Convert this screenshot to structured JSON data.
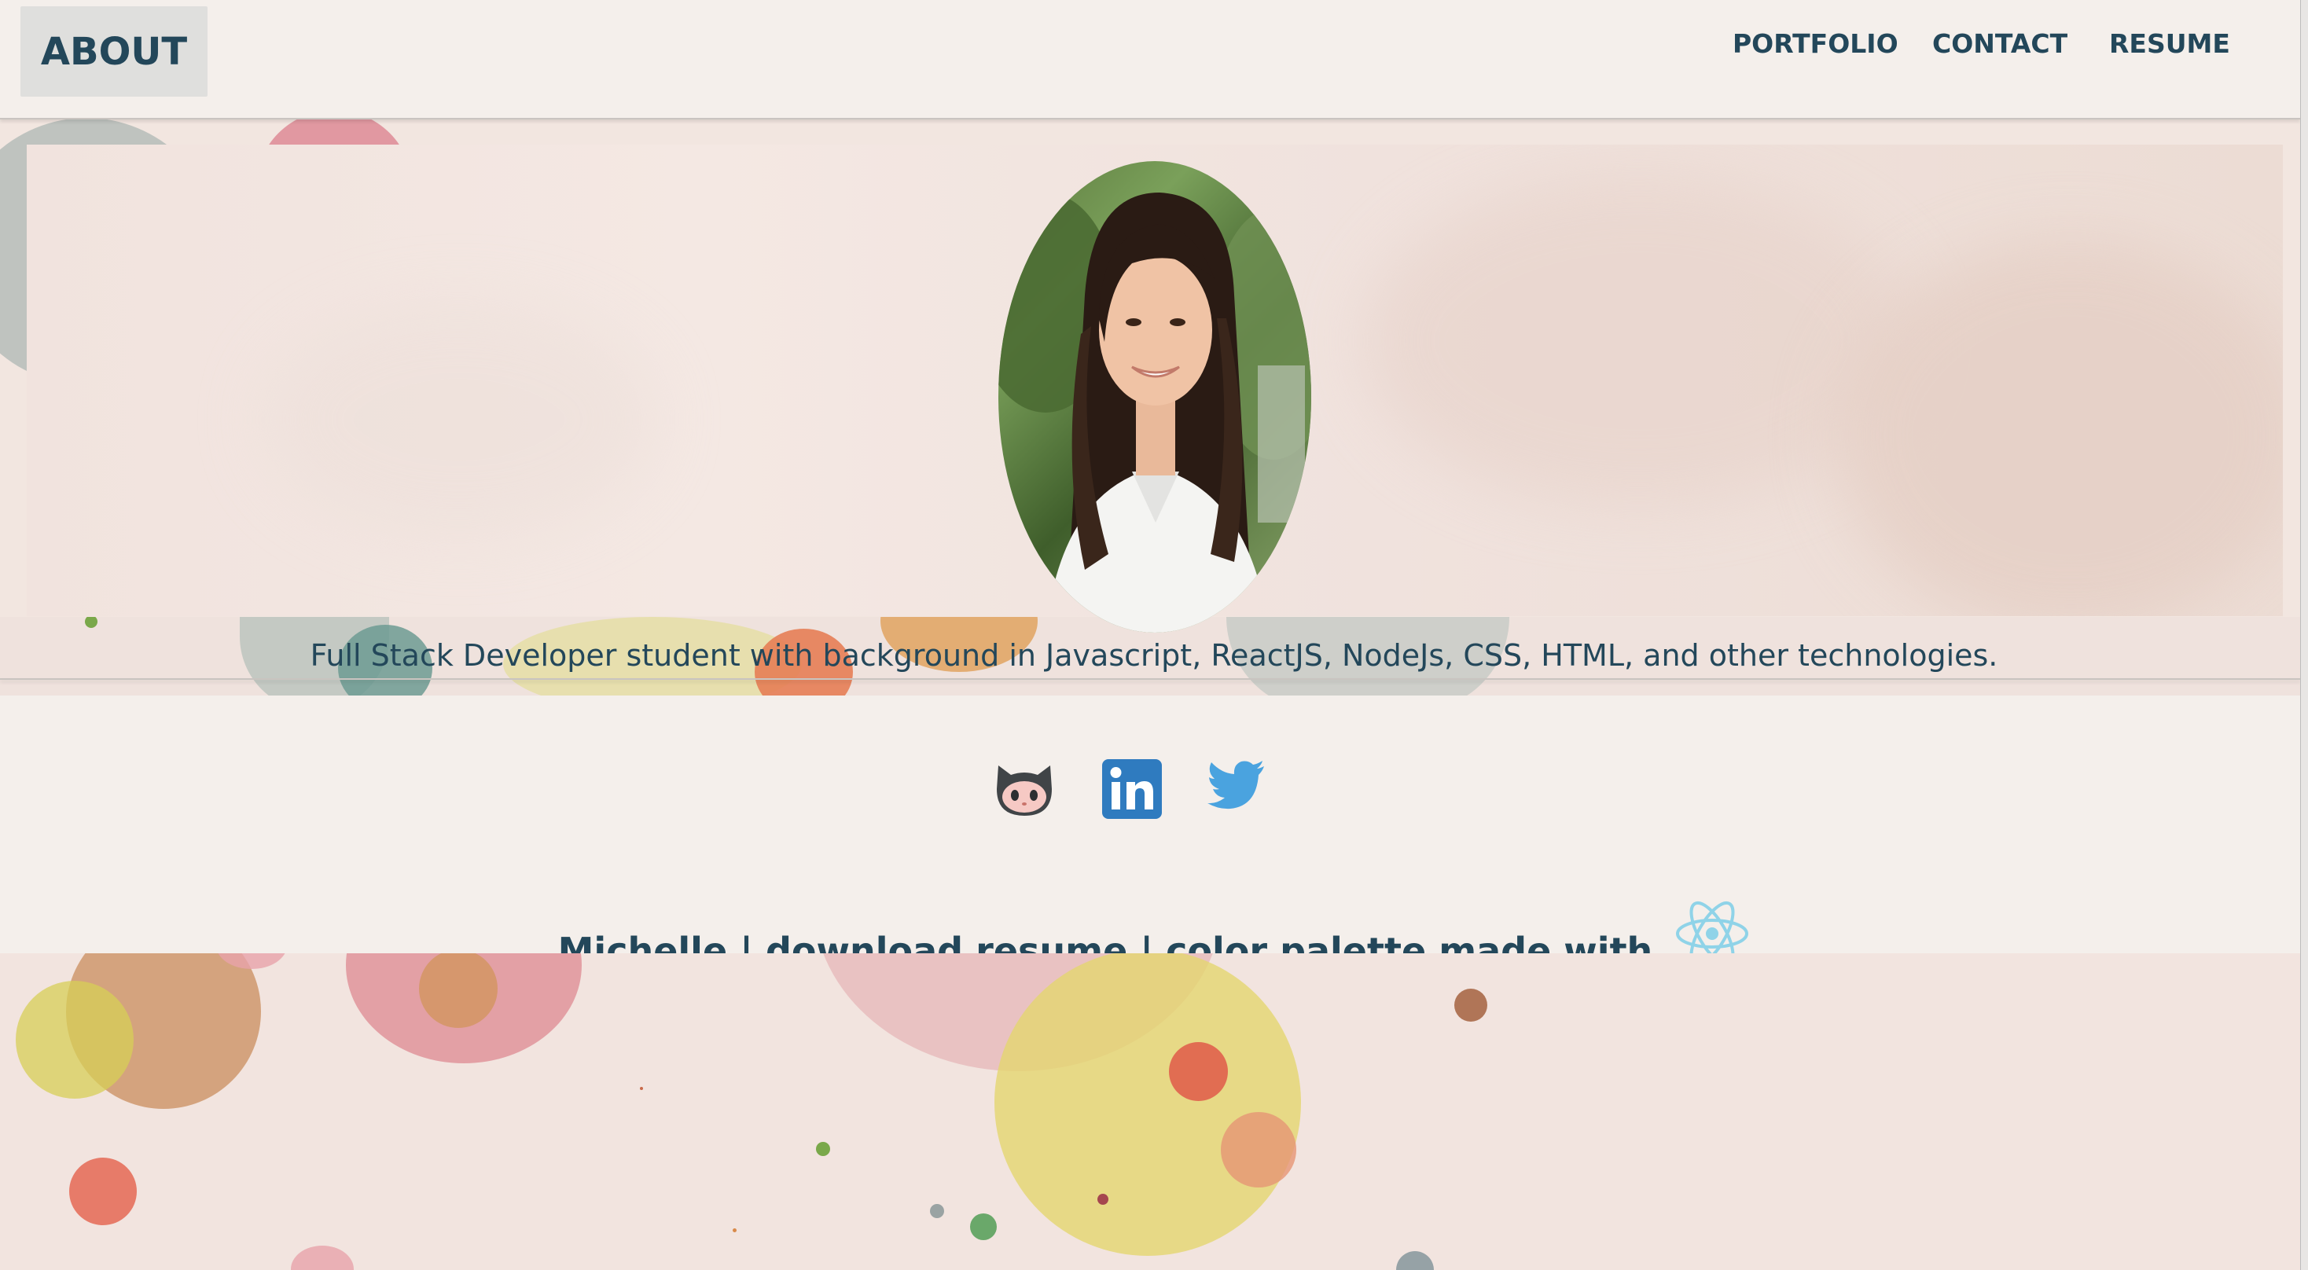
{
  "header": {
    "brand": "ABOUT",
    "nav": [
      "PORTFOLIO",
      "CONTACT",
      "RESUME"
    ]
  },
  "hero": {
    "tagline": "Full Stack Developer student with background in Javascript, ReactJS, NodeJs, CSS, HTML, and other technologies."
  },
  "social": {
    "icons": [
      "github-octocat-icon",
      "linkedin-icon",
      "twitter-icon"
    ]
  },
  "footer": {
    "name": "Michelle",
    "separator": "|",
    "download": "download resume",
    "palette": "color palette made with",
    "react_icon": "react-icon"
  },
  "colors": {
    "text": "#23475a",
    "background": "#f4efeb",
    "linkedin": "#2f7bbf",
    "twitter": "#4aa3df",
    "react": "#8fd3e8"
  }
}
